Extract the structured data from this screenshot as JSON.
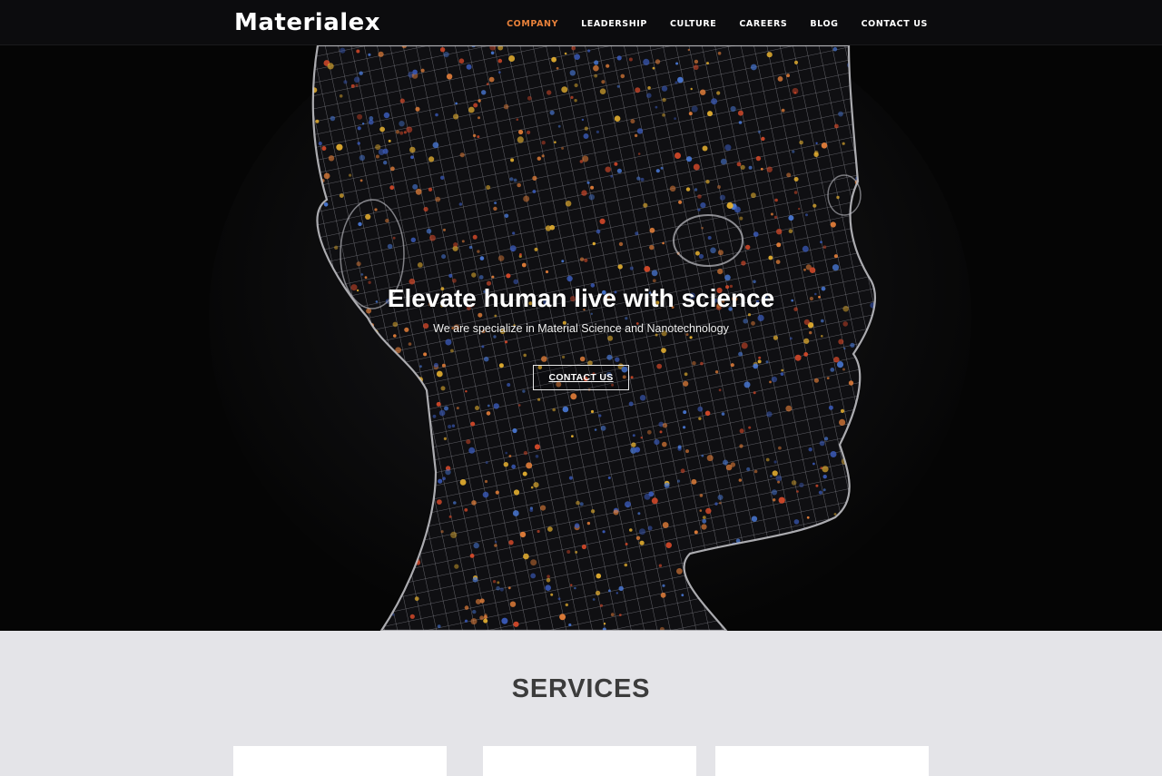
{
  "brand": {
    "logo_text": "Materialex"
  },
  "nav": {
    "items": [
      {
        "label": "COMPANY",
        "active": true
      },
      {
        "label": "LEADERSHIP",
        "active": false
      },
      {
        "label": "CULTURE",
        "active": false
      },
      {
        "label": "CAREERS",
        "active": false
      },
      {
        "label": "BLOG",
        "active": false
      },
      {
        "label": "CONTACT US",
        "active": false
      }
    ],
    "active_color": "#e8813a"
  },
  "hero": {
    "title": "Elevate human live with science",
    "subtitle": "We are specialize in Material Science and Nanotechnology",
    "cta_label": "CONTACT US",
    "image": "wireframe-human-head-with-colored-particles"
  },
  "services": {
    "title": "SERVICES",
    "cards": [
      {},
      {},
      {}
    ]
  }
}
